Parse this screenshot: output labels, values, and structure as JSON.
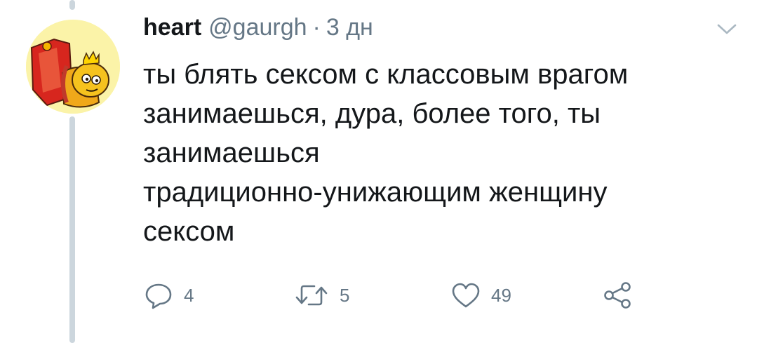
{
  "tweet": {
    "author": {
      "display_name": "heart",
      "handle": "@gaurgh"
    },
    "separator": "·",
    "time": "3 дн",
    "text_lines": [
      "ты блять сексом с классовым врагом",
      "занимаешься, дура, более того, ты",
      "занимаешься",
      "традиционно-унижающим женщину",
      "сексом"
    ],
    "actions": {
      "replies": "4",
      "retweets": "5",
      "likes": "49"
    },
    "icons": {
      "reply": "reply-icon",
      "retweet": "retweet-icon",
      "like": "heart-icon",
      "share": "share-icon",
      "menu": "chevron-down-icon"
    }
  },
  "colors": {
    "text": "#14171a",
    "secondary": "#657786",
    "thread_line": "#ccd6dd",
    "avatar_bg": "#fbf3a8"
  }
}
